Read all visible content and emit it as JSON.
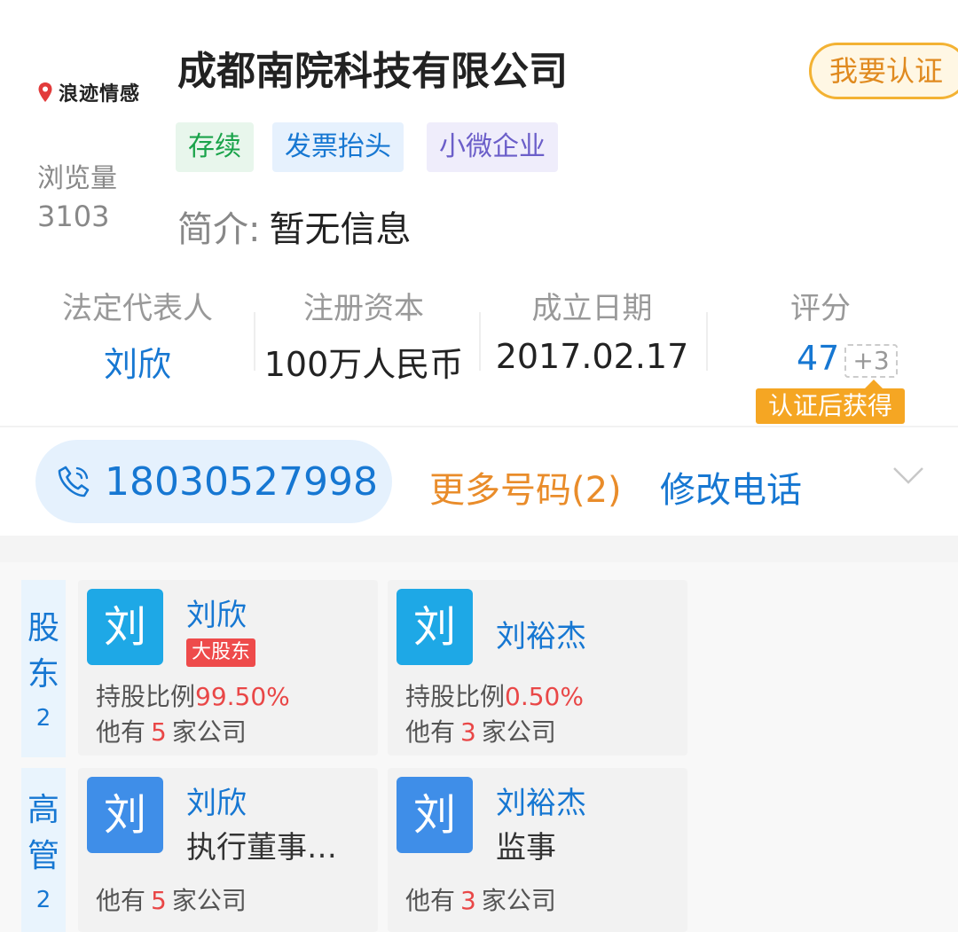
{
  "brand": {
    "logo_text": "浪迹情感",
    "accent": "#e23b3b"
  },
  "company": {
    "name": "成都南院科技有限公司",
    "verify_button": "我要认证",
    "tags": {
      "status": "存续",
      "invoice": "发票抬头",
      "scale": "小微企业"
    },
    "views_label": "浏览量",
    "views_value": "3103",
    "intro_label": "简介:",
    "intro_value": "暂无信息"
  },
  "stats": {
    "legal_rep": {
      "label": "法定代表人",
      "value": "刘欣"
    },
    "capital": {
      "label": "注册资本",
      "value": "100万人民币"
    },
    "founded": {
      "label": "成立日期",
      "value": "2017.02.17"
    },
    "score": {
      "label": "评分",
      "value": "47",
      "bonus": "+3",
      "bonus_note": "认证后获得"
    }
  },
  "contact": {
    "phone_icon": "phone-icon",
    "phone": "18030527998",
    "more_numbers": "更多号码(2)",
    "edit_phone": "修改电话",
    "expand_icon": "chevron-down-icon"
  },
  "shareholders": {
    "label_chars": [
      "股",
      "东"
    ],
    "count": "2",
    "items": [
      {
        "avatar": "刘",
        "name": "刘欣",
        "badge": "大股东",
        "ratio_label": "持股比例",
        "ratio": "99.50%",
        "companies_prefix": "他有",
        "companies_count": "5",
        "companies_suffix": "家公司"
      },
      {
        "avatar": "刘",
        "name": "刘裕杰",
        "ratio_label": "持股比例",
        "ratio": "0.50%",
        "companies_prefix": "他有",
        "companies_count": "3",
        "companies_suffix": "家公司"
      }
    ]
  },
  "executives": {
    "label_chars": [
      "高",
      "管"
    ],
    "count": "2",
    "items": [
      {
        "avatar": "刘",
        "name": "刘欣",
        "role": "执行董事…",
        "companies_prefix": "他有",
        "companies_count": "5",
        "companies_suffix": "家公司"
      },
      {
        "avatar": "刘",
        "name": "刘裕杰",
        "role": "监事",
        "companies_prefix": "他有",
        "companies_count": "3",
        "companies_suffix": "家公司"
      }
    ]
  },
  "colors": {
    "primary_blue": "#1677d2",
    "orange": "#e98c2a",
    "badge_orange": "#f5a623",
    "red": "#e94747",
    "green": "#1aa34a"
  }
}
